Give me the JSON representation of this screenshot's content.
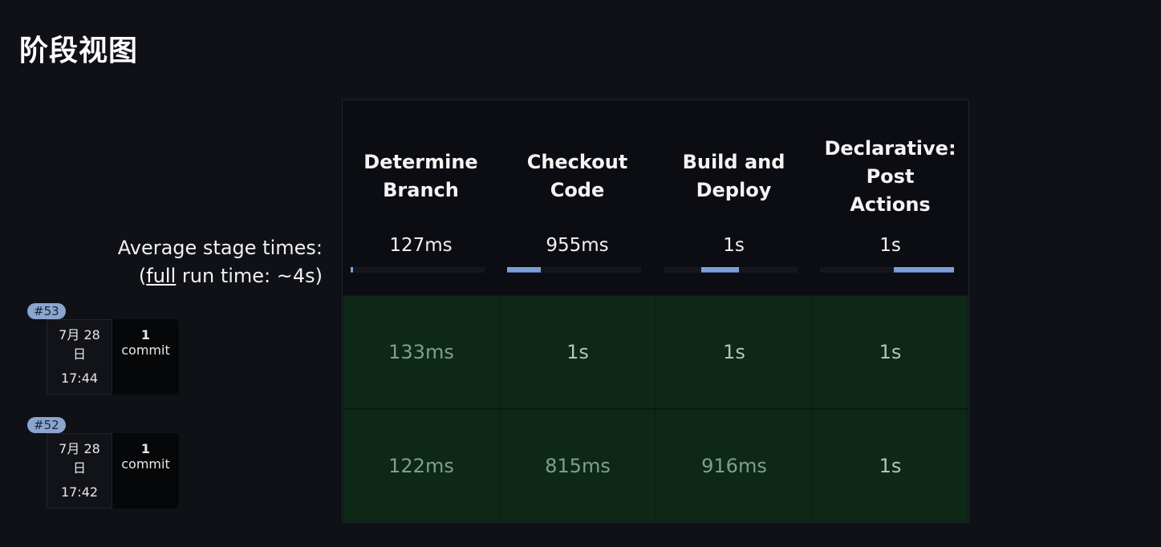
{
  "page": {
    "title": "阶段视图"
  },
  "summary": {
    "avg_label": "Average stage times:",
    "run_prefix": "(",
    "run_link": "full",
    "run_suffix": " run time: ~4s)"
  },
  "stages": [
    {
      "name": "Determine\nBranch",
      "avg": "127ms",
      "bar_start": 0.0,
      "bar_fraction": 0.02
    },
    {
      "name": "Checkout\nCode",
      "avg": "955ms",
      "bar_start": 0.0,
      "bar_fraction": 0.25
    },
    {
      "name": "Build and\nDeploy",
      "avg": "1s",
      "bar_start": 0.28,
      "bar_fraction": 0.28
    },
    {
      "name": "Declarative:\nPost\nActions",
      "avg": "1s",
      "bar_start": 0.55,
      "bar_fraction": 0.45
    }
  ],
  "builds": [
    {
      "id": "#53",
      "date": "7月 28\n日",
      "time": "17:44",
      "commits": "1",
      "commit_label": "commit",
      "times": [
        "133ms",
        "1s",
        "1s",
        "1s"
      ]
    },
    {
      "id": "#52",
      "date": "7月 28\n日",
      "time": "17:42",
      "commits": "1",
      "commit_label": "commit",
      "times": [
        "122ms",
        "815ms",
        "916ms",
        "1s"
      ]
    }
  ],
  "colors": {
    "success_cell": "#0e2818",
    "avg_bar": "#7a9fd6",
    "badge": "#8aa6cf"
  }
}
